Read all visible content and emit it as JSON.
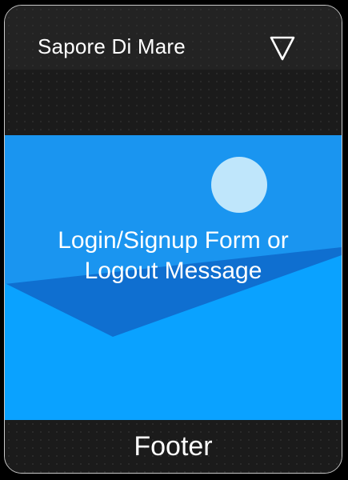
{
  "header": {
    "title": "Sapore Di Mare",
    "menu_icon": "triangle-down-icon"
  },
  "hero": {
    "text": "Login/Signup Form or Logout Message",
    "circle_icon": "circle-icon",
    "colors": {
      "background": "#1a95f0",
      "shape_dark": "#0f6fd0",
      "shape_light": "#0aa2ff",
      "circle": "#bfe6fb"
    }
  },
  "footer": {
    "text": "Footer"
  }
}
